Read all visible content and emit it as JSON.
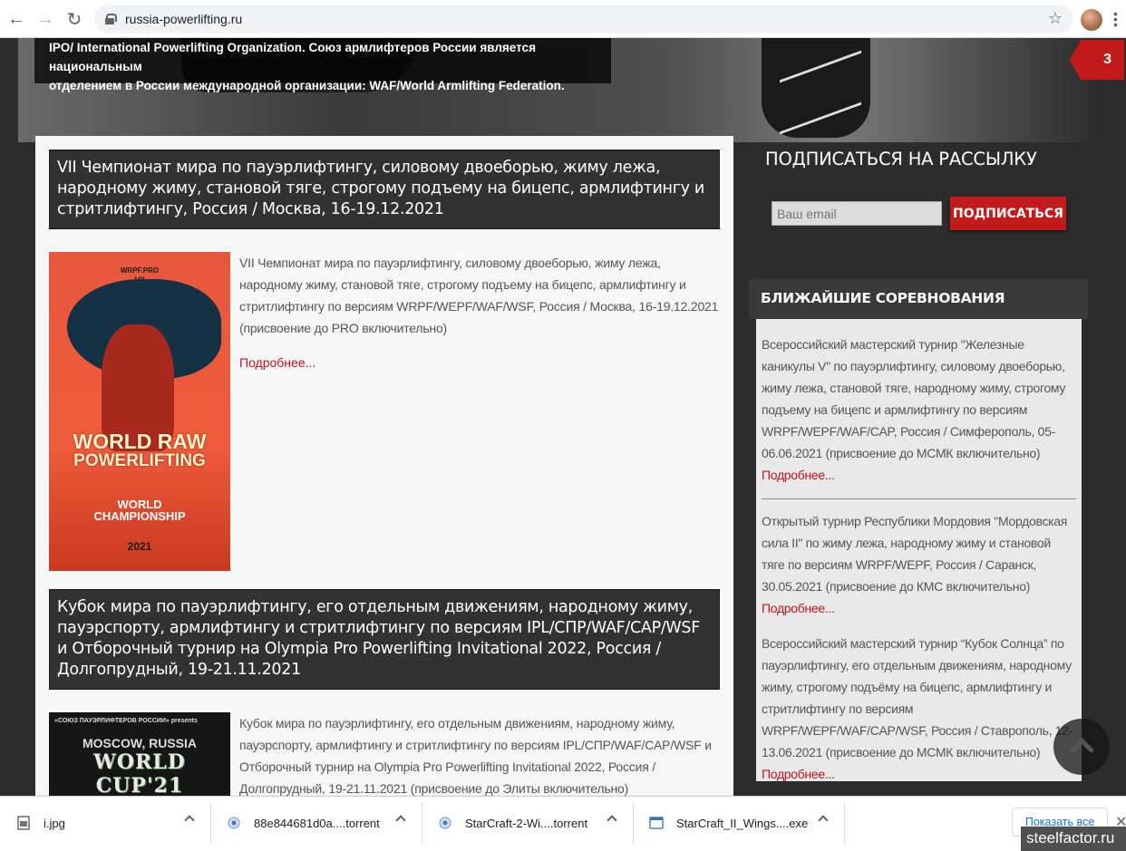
{
  "browser": {
    "url": "russia-powerlifting.ru"
  },
  "hero": {
    "text_line1": "IPO/ International Powerlifting Organization. Союз армлифтеров России является национальным",
    "text_line2": "отделением в России международной организации: WAF/World Armlifting Federation.",
    "badge_count": "3"
  },
  "posts": [
    {
      "title": "VII Чемпионат мира по пауэрлифтингу, силовому двоеборью, жиму лежа, народному жиму, становой тяге, строгому подъему на бицепс, армлифтингу и стритлифтингу, Россия / Москва, 16-19.12.2021",
      "excerpt": "VII Чемпионат мира по пауэрлифтингу, силовому двоеборью, жиму лежа, народному жиму, становой тяге, строгому подъему на бицепс, армлифтингу и стритлифтингу по версиям WRPF/WEPF/WAF/WSF, Россия / Москва, 16-19.12.2021 (присвоение до PRO включительно)",
      "more": "Подробнее...",
      "poster": {
        "top": "WRPF.PRO",
        "roman": "VII",
        "line1": "WORLD RAW",
        "line2": "POWERLIFTING",
        "line3": "WORLD",
        "line4": "CHAMPIONSHIP",
        "year": "2021"
      }
    },
    {
      "title": "Кубок мира по пауэрлифтингу, его отдельным движениям, народному жиму, пауэрспорту, армлифтингу и стритлифтингу по версиям IPL/СПР/WAF/CAP/WSF и Отборочный турнир на Olympia Pro Powerlifting Invitational 2022, Россия / Долгопрудный, 19-21.11.2021",
      "excerpt": "Кубок мира по пауэрлифтингу, его отдельным движениям, народному жиму, пауэрспорту, армлифтингу и стритлифтингу по версиям IPL/СПР/WAF/CAP/WSF и Отборочный турнир на Olympia Pro Powerlifting Invitational 2022, Россия / Долгопрудный, 19-21.11.2021 (присвоение до Элиты включительно)",
      "poster": {
        "top": "«СОЮЗ ПАУЭРЛИФТЕРОВ РОССИИ» presents",
        "city": "MOSCOW, RUSSIA",
        "cup": "WORLD CUP'21"
      }
    }
  ],
  "sidebar": {
    "subscribe_title": "ПОДПИСАТЬСЯ НА РАССЫЛКУ",
    "email_placeholder": "Ваш email",
    "subscribe_button": "ПОДПИСАТЬСЯ",
    "competitions_title": "БЛИЖАЙШИЕ СОРЕВНОВАНИЯ",
    "competitions": [
      {
        "text": "Всероссийский мастерский турнир \"Железные каникулы V\" по пауэрлифтингу, силовому двоеборью, жиму лежа, становой тяге, народному жиму, строгому подъему на бицепс и армлифтингу по версиям WRPF/WEPF/WAF/CAP, Россия / Симферополь, 05-06.06.2021 (присвоение до МСМК включительно)",
        "more": "Подробнее..."
      },
      {
        "text": "Открытый турнир Республики Мордовия \"Мордовская сила II\" по жиму лежа, народному жиму и становой тяге по версиям WRPF/WEPF, Россия / Саранск, 30.05.2021 (присвоение до КМС включительно)",
        "more": "Подробнее..."
      },
      {
        "text": "Всероссийский мастерский турнир “Кубок Солнца” по пауэрлифтингу, его отдельным движениям, народному жиму, строгому подъёму на бицепс, армлифтингу и стритлифтингу по версиям WRPF/WEPF/WAF/CAP/WSF, Россия / Ставрополь, 12-13.06.2021 (присвоение до МСМК включительно)",
        "more": "Подробнее..."
      }
    ]
  },
  "downloads": {
    "items": [
      {
        "name": "i.jpg",
        "icon": "image-file-icon"
      },
      {
        "name": "88e844681d0a....torrent",
        "icon": "torrent-file-icon"
      },
      {
        "name": "StarCraft-2-Wi....torrent",
        "icon": "torrent-file-icon"
      },
      {
        "name": "StarCraft_II_Wings....exe",
        "icon": "exe-file-icon"
      }
    ],
    "show_all": "Показать все"
  },
  "watermark": "steelfactor.ru"
}
